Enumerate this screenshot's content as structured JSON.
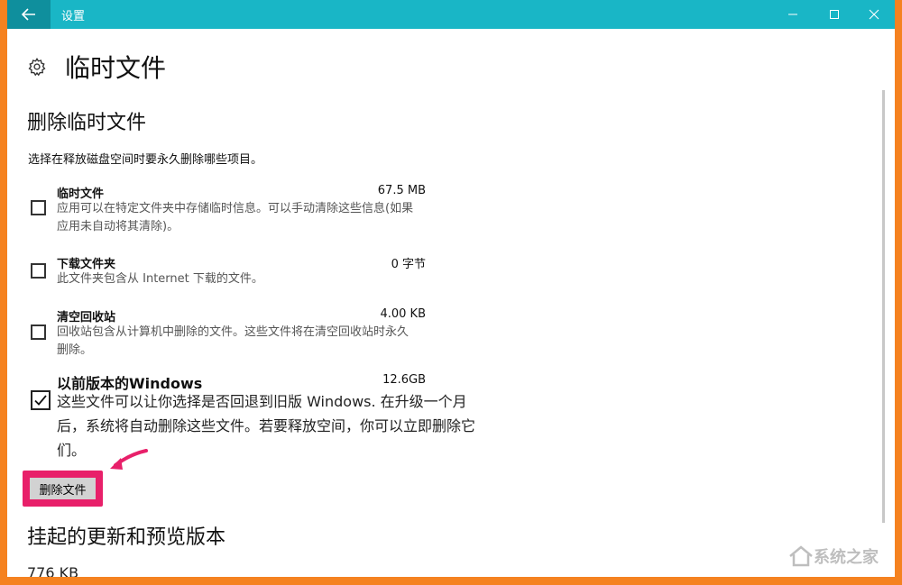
{
  "window": {
    "title": "设置"
  },
  "page": {
    "title": "临时文件"
  },
  "section1": {
    "heading": "删除临时文件",
    "description": "选择在释放磁盘空间时要永久删除哪些项目。"
  },
  "items": [
    {
      "name": "临时文件",
      "size": "67.5 MB",
      "desc": "应用可以在特定文件夹中存储临时信息。可以手动清除这些信息(如果应用未自动将其清除)。",
      "checked": false
    },
    {
      "name": "下载文件夹",
      "size": "0 字节",
      "desc": "此文件夹包含从 Internet 下载的文件。",
      "checked": false
    },
    {
      "name": "清空回收站",
      "size": "4.00 KB",
      "desc": "回收站包含从计算机中删除的文件。这些文件将在清空回收站时永久删除。",
      "checked": false
    },
    {
      "name": "以前版本的Windows",
      "size": "12.6GB",
      "desc": "这些文件可以让你选择是否回退到旧版 Windows. 在升级一个月后，系统将自动删除这些文件。若要释放空间，你可以立即删除它们。",
      "checked": true
    }
  ],
  "actions": {
    "delete_label": "删除文件"
  },
  "section2": {
    "heading": "挂起的更新和预览版本",
    "size": "776 KB"
  },
  "watermark": {
    "text": "系统之家"
  },
  "colors": {
    "titlebar": "#19b6c6",
    "highlight": "#e8206a",
    "frame": "#f58220"
  }
}
